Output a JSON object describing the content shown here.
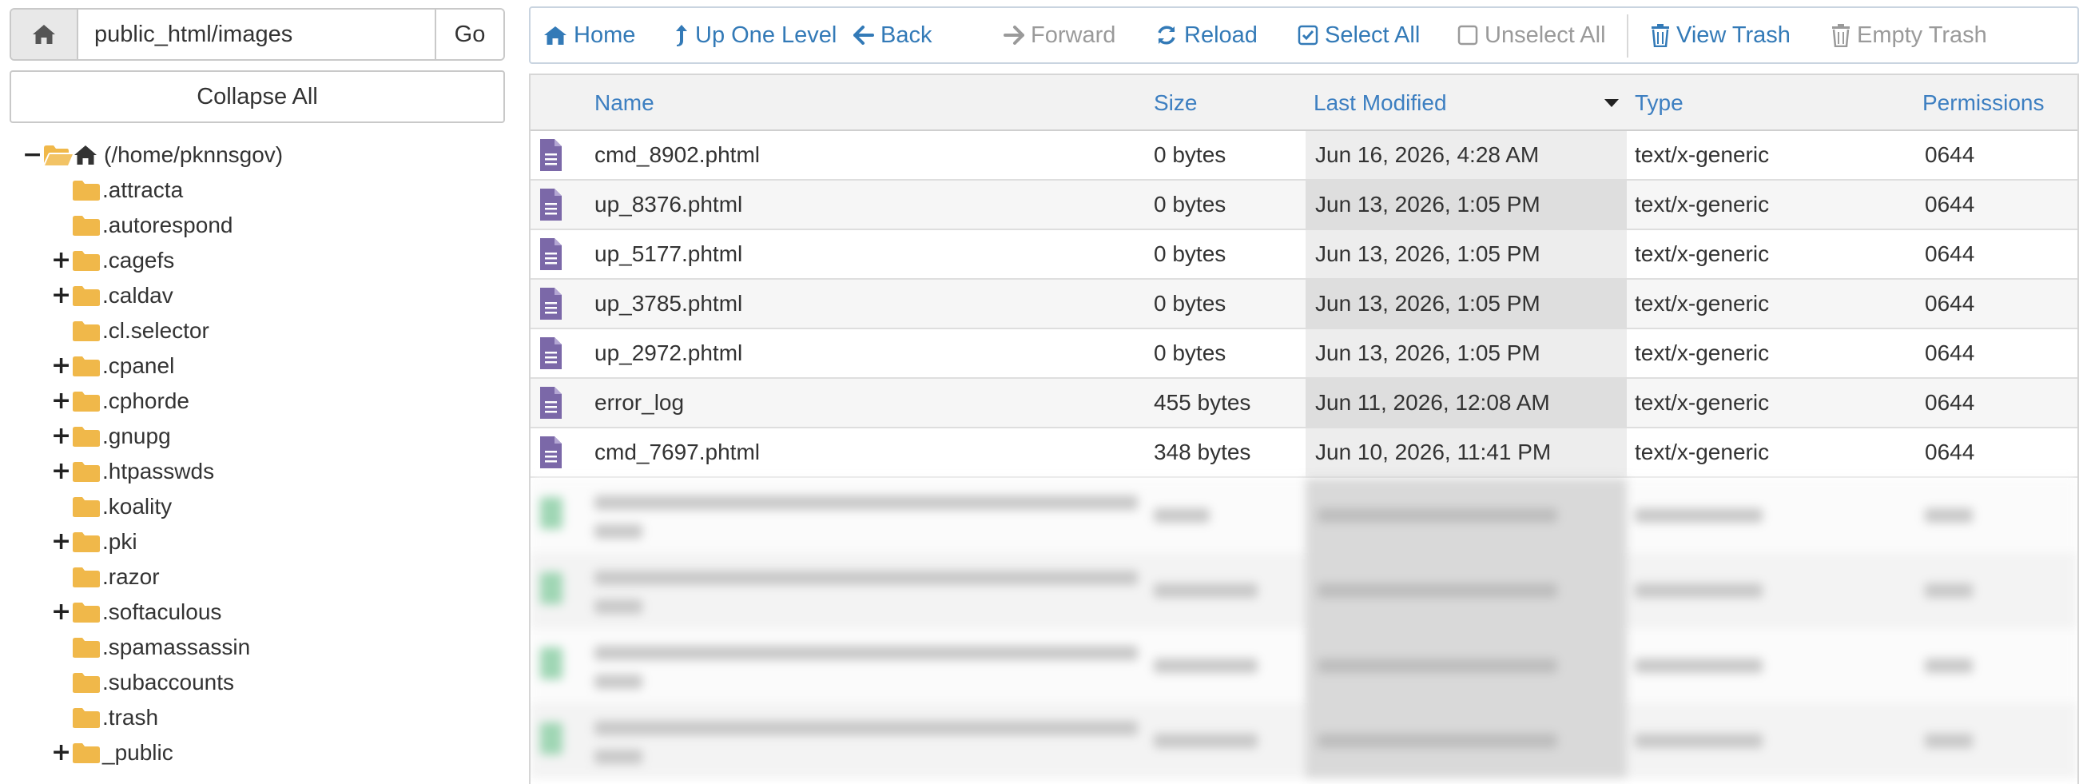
{
  "path_bar": {
    "value": "public_html/images",
    "go_label": "Go"
  },
  "tree_controls": {
    "collapse_label": "Collapse All"
  },
  "tree": {
    "root_label": "(/home/pknnsgov)",
    "items": [
      {
        "label": ".attracta",
        "expandable": false
      },
      {
        "label": ".autorespond",
        "expandable": false
      },
      {
        "label": ".cagefs",
        "expandable": true
      },
      {
        "label": ".caldav",
        "expandable": true
      },
      {
        "label": ".cl.selector",
        "expandable": false
      },
      {
        "label": ".cpanel",
        "expandable": true
      },
      {
        "label": ".cphorde",
        "expandable": true
      },
      {
        "label": ".gnupg",
        "expandable": true
      },
      {
        "label": ".htpasswds",
        "expandable": true
      },
      {
        "label": ".koality",
        "expandable": false
      },
      {
        "label": ".pki",
        "expandable": true
      },
      {
        "label": ".razor",
        "expandable": false
      },
      {
        "label": ".softaculous",
        "expandable": true
      },
      {
        "label": ".spamassassin",
        "expandable": false
      },
      {
        "label": ".subaccounts",
        "expandable": false
      },
      {
        "label": ".trash",
        "expandable": false
      },
      {
        "label": "_public",
        "expandable": true
      }
    ]
  },
  "toolbar": {
    "home": "Home",
    "up_one_level": "Up One Level",
    "back": "Back",
    "forward": "Forward",
    "reload": "Reload",
    "select_all": "Select All",
    "unselect_all": "Unselect All",
    "view_trash": "View Trash",
    "empty_trash": "Empty Trash"
  },
  "columns": {
    "name": "Name",
    "size": "Size",
    "last_modified": "Last Modified",
    "type": "Type",
    "permissions": "Permissions"
  },
  "files": [
    {
      "name": "cmd_8902.phtml",
      "size": "0 bytes",
      "modified": "Jun 16, 2026, 4:28 AM",
      "type": "text/x-generic",
      "perms": "0644"
    },
    {
      "name": "up_8376.phtml",
      "size": "0 bytes",
      "modified": "Jun 13, 2026, 1:05 PM",
      "type": "text/x-generic",
      "perms": "0644"
    },
    {
      "name": "up_5177.phtml",
      "size": "0 bytes",
      "modified": "Jun 13, 2026, 1:05 PM",
      "type": "text/x-generic",
      "perms": "0644"
    },
    {
      "name": "up_3785.phtml",
      "size": "0 bytes",
      "modified": "Jun 13, 2026, 1:05 PM",
      "type": "text/x-generic",
      "perms": "0644"
    },
    {
      "name": "up_2972.phtml",
      "size": "0 bytes",
      "modified": "Jun 13, 2026, 1:05 PM",
      "type": "text/x-generic",
      "perms": "0644"
    },
    {
      "name": "error_log",
      "size": "455 bytes",
      "modified": "Jun 11, 2026, 12:08 AM",
      "type": "text/x-generic",
      "perms": "0644"
    },
    {
      "name": "cmd_7697.phtml",
      "size": "348 bytes",
      "modified": "Jun 10, 2026, 11:41 PM",
      "type": "text/x-generic",
      "perms": "0644"
    }
  ],
  "colors": {
    "link": "#337ab7",
    "header_link": "#3d7fc1",
    "disabled": "#9a9a9a",
    "folder": "#f0b84a",
    "text_file_icon": "#7b68a8",
    "image_file_icon": "#9fd6b4"
  }
}
